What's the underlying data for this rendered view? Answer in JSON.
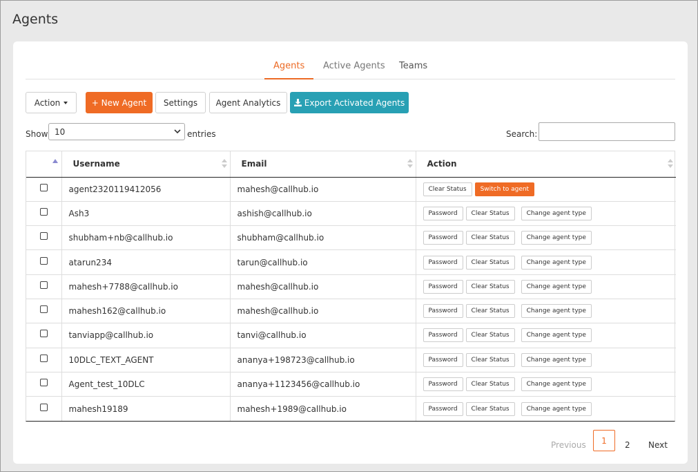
{
  "page": {
    "title": "Agents"
  },
  "tabs": [
    {
      "label": "Agents",
      "active": true
    },
    {
      "label": "Active Agents",
      "active": false
    },
    {
      "label": "Teams",
      "active": false
    }
  ],
  "toolbar": {
    "action_label": "Action",
    "new_agent_label": "+ New Agent",
    "settings_label": "Settings",
    "analytics_label": "Agent Analytics",
    "export_label": "Export Activated Agents"
  },
  "entries": {
    "show_label": "Show",
    "selected": "10",
    "suffix_label": "entries"
  },
  "search": {
    "label": "Search:",
    "value": "",
    "placeholder": ""
  },
  "table": {
    "headers": {
      "username": "Username",
      "email": "Email",
      "action": "Action"
    },
    "button_labels": {
      "password": "Password",
      "clear_status": "Clear Status",
      "change_type": "Change agent type",
      "switch": "Switch to agent"
    },
    "rows": [
      {
        "username": "agent2320119412056",
        "email": "mahesh@callhub.io"
      },
      {
        "username": "Ash3",
        "email": "ashish@callhub.io"
      },
      {
        "username": "shubham+nb@callhub.io",
        "email": "shubham@callhub.io"
      },
      {
        "username": "atarun234",
        "email": "tarun@callhub.io"
      },
      {
        "username": "mahesh+7788@callhub.io",
        "email": "mahesh@callhub.io"
      },
      {
        "username": "mahesh162@callhub.io",
        "email": "mahesh@callhub.io"
      },
      {
        "username": "tanviapp@callhub.io",
        "email": "tanvi@callhub.io"
      },
      {
        "username": "10DLC_TEXT_AGENT",
        "email": "ananya+198723@callhub.io"
      },
      {
        "username": "Agent_test_10DLC",
        "email": "ananya+1123456@callhub.io"
      },
      {
        "username": "mahesh19189",
        "email": "mahesh+1989@callhub.io"
      }
    ]
  },
  "pagination": {
    "previous": "Previous",
    "pages": [
      "1",
      "2"
    ],
    "current": "1",
    "next": "Next"
  },
  "colors": {
    "accent": "#ef6b25",
    "teal": "#28a0b4"
  }
}
